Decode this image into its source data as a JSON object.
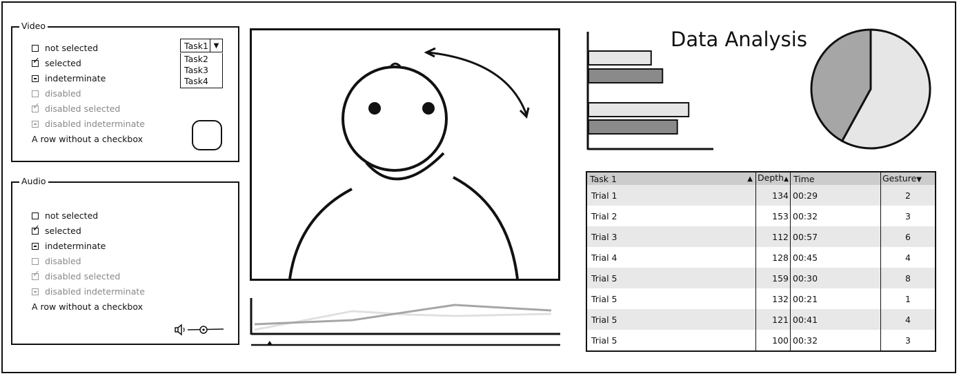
{
  "video_group": {
    "title": "Video",
    "rows": [
      {
        "label": "not selected",
        "state": "unchecked",
        "disabled": false
      },
      {
        "label": "selected",
        "state": "checked",
        "disabled": false
      },
      {
        "label": "indeterminate",
        "state": "indeterminate",
        "disabled": false
      },
      {
        "label": "disabled",
        "state": "unchecked",
        "disabled": true
      },
      {
        "label": "disabled selected",
        "state": "checked",
        "disabled": true
      },
      {
        "label": "disabled indeterminate",
        "state": "indeterminate",
        "disabled": true
      }
    ],
    "plain_row": "A row without a checkbox",
    "dropdown": {
      "selected": "Task1",
      "options": [
        "Task2",
        "Task3",
        "Task4"
      ]
    }
  },
  "audio_group": {
    "title": "Audio",
    "rows": [
      {
        "label": "not selected",
        "state": "unchecked",
        "disabled": false
      },
      {
        "label": "selected",
        "state": "checked",
        "disabled": false
      },
      {
        "label": "indeterminate",
        "state": "indeterminate",
        "disabled": false
      },
      {
        "label": "disabled",
        "state": "unchecked",
        "disabled": true
      },
      {
        "label": "disabled selected",
        "state": "checked",
        "disabled": true
      },
      {
        "label": "disabled indeterminate",
        "state": "indeterminate",
        "disabled": true
      }
    ],
    "plain_row": "A row without a checkbox",
    "volume_icon": "speaker-icon"
  },
  "analysis": {
    "title": "Data Analysis",
    "bars": [
      0.55,
      0.65,
      0.88,
      0.78
    ],
    "bar_colors": [
      "#e6e6e6",
      "#8a8a8a",
      "#e6e6e6",
      "#8a8a8a"
    ],
    "pie": [
      0.58,
      0.42
    ],
    "pie_colors": [
      "#e6e6e6",
      "#a6a6a6"
    ]
  },
  "timeline": {
    "series_colors": [
      "#e0e0e0",
      "#a6a6a6"
    ],
    "scrubber": 0.06
  },
  "table": {
    "columns": [
      "Task 1",
      "Depth",
      "Time",
      "Gesture"
    ],
    "sort_icons": [
      "sort-asc-icon",
      "sort-both-icon",
      "",
      "sort-desc-icon"
    ],
    "rows": [
      {
        "task": "Trial 1",
        "depth": "134",
        "time": "00:29",
        "gesture": "2"
      },
      {
        "task": "Trial 2",
        "depth": "153",
        "time": "00:32",
        "gesture": "3"
      },
      {
        "task": "Trial 3",
        "depth": "112",
        "time": "00:57",
        "gesture": "6"
      },
      {
        "task": "Trial 4",
        "depth": "128",
        "time": "00:45",
        "gesture": "4"
      },
      {
        "task": "Trial 5",
        "depth": "159",
        "time": "00:30",
        "gesture": "8"
      },
      {
        "task": "Trial 5",
        "depth": "132",
        "time": "00:21",
        "gesture": "1"
      },
      {
        "task": "Trial 5",
        "depth": "121",
        "time": "00:41",
        "gesture": "4"
      },
      {
        "task": "Trial 5",
        "depth": "100",
        "time": "00:32",
        "gesture": "3"
      }
    ]
  }
}
